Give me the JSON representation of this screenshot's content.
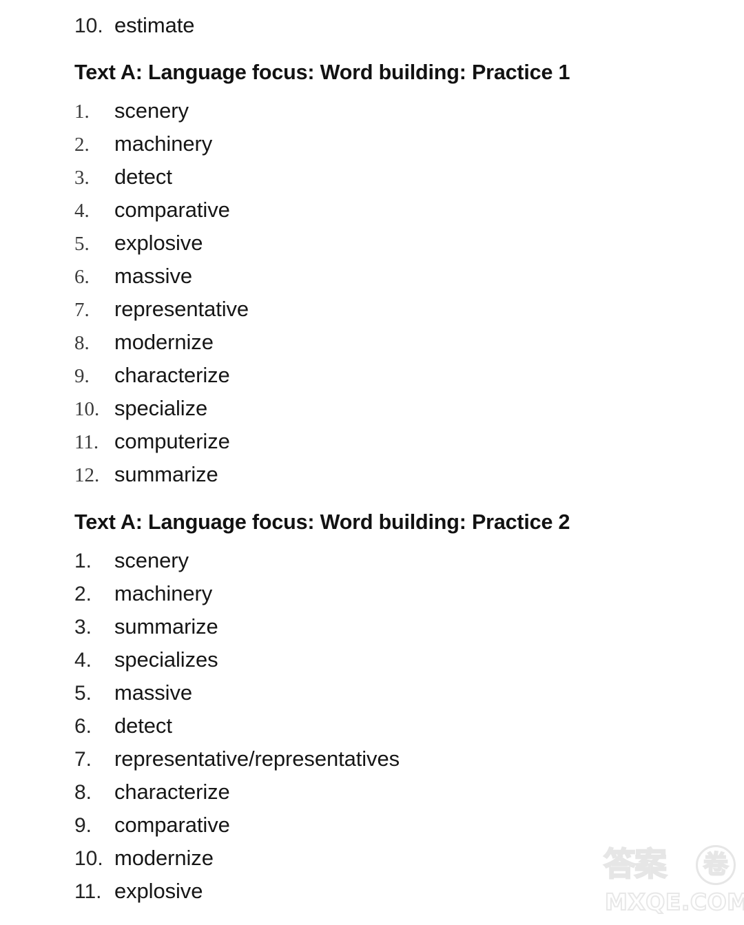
{
  "document": {
    "background_color": "#ffffff",
    "text_color": "#161616"
  },
  "orphan_item": {
    "number": "10.",
    "word": "estimate"
  },
  "sections": [
    {
      "heading": "Text A: Language focus: Word building: Practice 1",
      "numeral_style": "serif",
      "items": [
        {
          "number": "1.",
          "word": "scenery"
        },
        {
          "number": "2.",
          "word": "machinery"
        },
        {
          "number": "3.",
          "word": "detect"
        },
        {
          "number": "4.",
          "word": "comparative"
        },
        {
          "number": "5.",
          "word": "explosive"
        },
        {
          "number": "6.",
          "word": "massive"
        },
        {
          "number": "7.",
          "word": "representative"
        },
        {
          "number": "8.",
          "word": "modernize"
        },
        {
          "number": "9.",
          "word": "characterize"
        },
        {
          "number": "10.",
          "word": "specialize"
        },
        {
          "number": "11.",
          "word": "computerize"
        },
        {
          "number": "12.",
          "word": "summarize"
        }
      ]
    },
    {
      "heading": "Text A: Language focus: Word building: Practice 2",
      "numeral_style": "sans",
      "items": [
        {
          "number": "1.",
          "word": "scenery"
        },
        {
          "number": "2.",
          "word": "machinery"
        },
        {
          "number": "3.",
          "word": "summarize"
        },
        {
          "number": "4.",
          "word": "specializes"
        },
        {
          "number": "5.",
          "word": "massive"
        },
        {
          "number": "6.",
          "word": "detect"
        },
        {
          "number": "7.",
          "word": "representative/representatives"
        },
        {
          "number": "8.",
          "word": "characterize"
        },
        {
          "number": "9.",
          "word": "comparative"
        },
        {
          "number": "10.",
          "word": "modernize"
        },
        {
          "number": "11.",
          "word": "explosive"
        }
      ]
    }
  ],
  "watermark": {
    "cjk_text": "答案",
    "circled_char": "卷",
    "domain": "MXQE.COM",
    "color": "#e6e6e6"
  }
}
